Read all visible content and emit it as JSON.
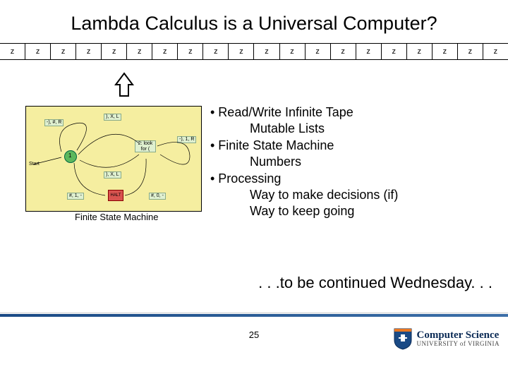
{
  "title": "Lambda Calculus is a Universal Computer?",
  "tape_cell": "z",
  "tape_count": 20,
  "fsm": {
    "caption": "Finite State Machine",
    "start": "Start",
    "halt": "HALT",
    "labels": {
      "top_left": "-), #, R",
      "top_mid": "), X, L",
      "right": "-), 1, R",
      "center": "2: look for (",
      "mid_low": "), X, L",
      "state1": "1",
      "bl": "#, 1, -",
      "br": "#, 0, -"
    }
  },
  "bullets": {
    "b1": "• Read/Write Infinite Tape",
    "b1a": "Mutable Lists",
    "b2": "• Finite State Machine",
    "b2a": "Numbers",
    "b3": "• Processing",
    "b3a": "Way to make decisions (if)",
    "b3b": "Way to keep going"
  },
  "continued": ". . .to be continued Wednesday. . .",
  "page_number": "25",
  "logo": {
    "line1": "Computer Science",
    "line2": "UNIVERSITY of VIRGINIA"
  }
}
